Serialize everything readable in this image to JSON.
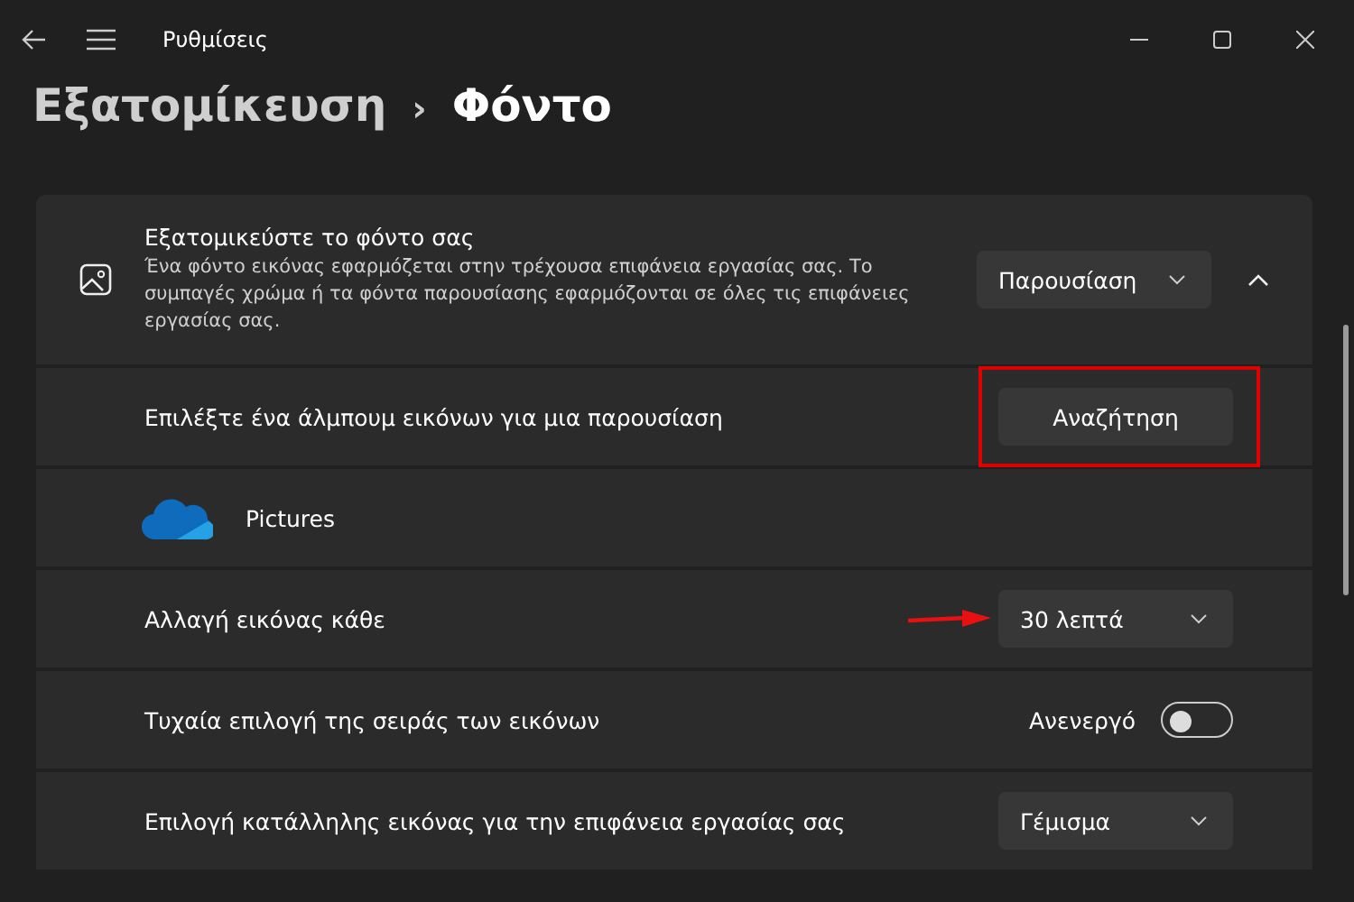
{
  "window": {
    "title": "Ρυθμίσεις"
  },
  "breadcrumb": {
    "parent": "Εξατομίκευση",
    "separator": "›",
    "current": "Φόντο"
  },
  "background_card": {
    "title": "Εξατομικεύστε το φόντο σας",
    "description": "Ένα φόντο εικόνας εφαρμόζεται στην τρέχουσα επιφάνεια εργασίας σας. Το συμπαγές χρώμα ή τα φόντα παρουσίασης εφαρμόζονται σε όλες τις επιφάνειες εργασίας σας.",
    "dropdown": "Παρουσίαση",
    "expanded": true
  },
  "rows": [
    {
      "kind": "button",
      "label": "Επιλέξτε ένα άλμπουμ εικόνων για μια παρουσίαση",
      "button": "Αναζήτηση",
      "highlighted": true
    },
    {
      "kind": "folder",
      "label": "Pictures"
    },
    {
      "kind": "dropdown",
      "label": "Αλλαγή εικόνας κάθε",
      "value": "30 λεπτά",
      "arrow": true
    },
    {
      "kind": "toggle",
      "label": "Τυχαία επιλογή της σειράς των εικόνων",
      "state_text": "Ανενεργό",
      "on": false
    },
    {
      "kind": "dropdown",
      "label": "Επιλογή κατάλληλης εικόνας για την επιφάνεια εργασίας σας",
      "value": "Γέμισμα",
      "arrow": false
    }
  ]
}
